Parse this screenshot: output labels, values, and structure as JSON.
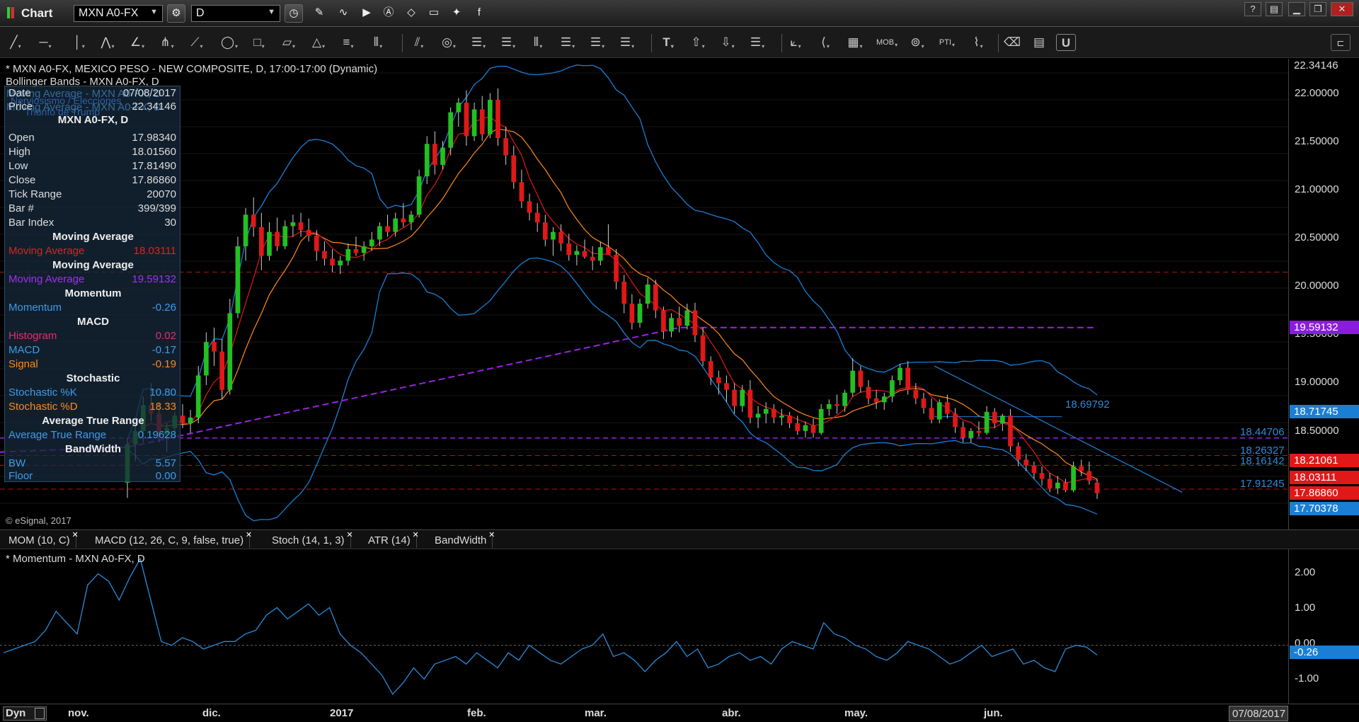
{
  "app": {
    "title": "Chart"
  },
  "toolbar": {
    "symbol": "MXN A0-FX",
    "interval": "D"
  },
  "pane": {
    "title": "* MXN A0-FX, MEXICO PESO - NEW COMPOSITE, D, 17:00-17:00 (Dynamic)",
    "study": "Bollinger Bands - MXN A0-FX, D",
    "copyright": "© eSignal, 2017"
  },
  "ghost_text": {
    "line1": "Moving Average - MXN A0-FX, D",
    "line2": "Moving Average - MXN A0-FX, D",
    "line3": "Nerviosismo / Elecciones",
    "line4": "Triunfo de Trump"
  },
  "data_window": {
    "date": {
      "label": "Date",
      "value": "07/08/2017"
    },
    "price": {
      "label": "Price",
      "value": "22.34146"
    },
    "symbol_header": "MXN A0-FX, D",
    "rows": [
      {
        "label": "Open",
        "value": "17.98340"
      },
      {
        "label": "High",
        "value": "18.01560"
      },
      {
        "label": "Low",
        "value": "17.81490"
      },
      {
        "label": "Close",
        "value": "17.86860"
      },
      {
        "label": "Tick Range",
        "value": "20070"
      },
      {
        "label": "Bar #",
        "value": "399/399"
      },
      {
        "label": "Bar Index",
        "value": "30"
      }
    ],
    "ma1_header": "Moving Average",
    "ma1": {
      "label": "Moving Average",
      "value": "18.03111"
    },
    "ma2_header": "Moving Average",
    "ma2": {
      "label": "Moving Average",
      "value": "19.59132"
    },
    "mom_header": "Momentum",
    "mom": {
      "label": "Momentum",
      "value": "-0.26"
    },
    "macd_header": "MACD",
    "macd_rows": [
      {
        "label": "Histogram",
        "value": "0.02"
      },
      {
        "label": "MACD",
        "value": "-0.17"
      },
      {
        "label": "Signal",
        "value": "-0.19"
      }
    ],
    "stoch_header": "Stochastic",
    "stoch_rows": [
      {
        "label": "Stochastic %K",
        "value": "10.80"
      },
      {
        "label": "Stochastic %D",
        "value": "18.33"
      }
    ],
    "atr_header": "Average True Range",
    "atr": {
      "label": "Average True Range",
      "value": "0.19628"
    },
    "bw_header": "BandWidth",
    "bw_rows": [
      {
        "label": "BW",
        "value": "5.57"
      },
      {
        "label": "Floor",
        "value": "0.00"
      }
    ]
  },
  "price_axis": {
    "ticks": [
      "22.00000",
      "21.50000",
      "21.00000",
      "20.50000",
      "20.00000",
      "19.50000",
      "19.00000",
      "18.50000"
    ],
    "top_value": "22.34146",
    "tags": [
      {
        "text": "19.59132",
        "color": "#8a1ce0"
      },
      {
        "text": "18.71745",
        "color": "#1a7fd4"
      },
      {
        "text": "18.21061",
        "color": "#e01818"
      },
      {
        "text": "18.03111",
        "color": "#e01818"
      },
      {
        "text": "17.86860",
        "color": "#e01818"
      },
      {
        "text": "17.70378",
        "color": "#1a7fd4"
      }
    ]
  },
  "level_labels": [
    "18.69792",
    "18.44706",
    "18.26327",
    "18.16142",
    "17.91245"
  ],
  "indicator_tabs": [
    "MOM (10, C)",
    "MACD (12, 26, C, 9, false, true)",
    "Stoch (14, 1, 3)",
    "ATR (14)",
    "BandWidth"
  ],
  "momentum_pane": {
    "title": "* Momentum - MXN A0-FX, D",
    "ticks": [
      "2.00",
      "1.00",
      "0.00",
      "-1.00"
    ],
    "tag": "-0.26"
  },
  "time_axis": {
    "mode": "Dyn",
    "labels": [
      "nov.",
      "dic.",
      "2017",
      "feb.",
      "mar.",
      "abr.",
      "may.",
      "jun."
    ],
    "cursor_date": "07/08/2017"
  },
  "colors": {
    "up_candle": "#22c022",
    "down_candle": "#e01818",
    "bollinger": "#1a7fd4",
    "ma_fast": "#e01818",
    "ma_slow": "#ff8a1a",
    "ma_200": "#9b22e6"
  },
  "chart_data": {
    "type": "candlestick",
    "symbol": "MXN A0-FX",
    "ylim": [
      17.55,
      22.35
    ],
    "candles": [
      [
        17.98,
        18.45,
        17.82,
        18.38
      ],
      [
        18.38,
        18.6,
        18.2,
        18.52
      ],
      [
        18.52,
        18.88,
        18.4,
        18.79
      ],
      [
        18.79,
        19.02,
        18.62,
        18.7
      ],
      [
        18.7,
        18.82,
        18.4,
        18.48
      ],
      [
        18.48,
        18.6,
        18.3,
        18.55
      ],
      [
        18.55,
        18.72,
        18.44,
        18.68
      ],
      [
        18.68,
        18.8,
        18.55,
        18.6
      ],
      [
        18.6,
        18.74,
        18.5,
        18.66
      ],
      [
        18.66,
        19.2,
        18.6,
        19.1
      ],
      [
        19.1,
        19.55,
        19.0,
        19.45
      ],
      [
        19.45,
        19.6,
        19.2,
        19.35
      ],
      [
        19.35,
        19.48,
        18.85,
        18.95
      ],
      [
        18.95,
        19.9,
        18.9,
        19.75
      ],
      [
        19.75,
        20.55,
        19.7,
        20.45
      ],
      [
        20.45,
        20.85,
        20.3,
        20.78
      ],
      [
        20.78,
        20.96,
        20.55,
        20.65
      ],
      [
        20.65,
        20.8,
        20.2,
        20.35
      ],
      [
        20.35,
        20.7,
        20.3,
        20.6
      ],
      [
        20.6,
        20.75,
        20.4,
        20.45
      ],
      [
        20.45,
        20.72,
        20.42,
        20.66
      ],
      [
        20.66,
        20.78,
        20.55,
        20.7
      ],
      [
        20.7,
        20.8,
        20.55,
        20.62
      ],
      [
        20.62,
        20.74,
        20.5,
        20.56
      ],
      [
        20.56,
        20.62,
        20.3,
        20.4
      ],
      [
        20.4,
        20.5,
        20.25,
        20.32
      ],
      [
        20.32,
        20.42,
        20.18,
        20.25
      ],
      [
        20.25,
        20.35,
        20.16,
        20.3
      ],
      [
        20.3,
        20.48,
        20.25,
        20.42
      ],
      [
        20.42,
        20.55,
        20.35,
        20.38
      ],
      [
        20.38,
        20.5,
        20.3,
        20.45
      ],
      [
        20.45,
        20.6,
        20.4,
        20.52
      ],
      [
        20.52,
        20.7,
        20.45,
        20.66
      ],
      [
        20.66,
        20.78,
        20.55,
        20.6
      ],
      [
        20.6,
        20.8,
        20.55,
        20.74
      ],
      [
        20.74,
        20.9,
        20.65,
        20.7
      ],
      [
        20.7,
        20.82,
        20.62,
        20.78
      ],
      [
        20.78,
        21.25,
        20.75,
        21.18
      ],
      [
        21.18,
        21.6,
        21.1,
        21.52
      ],
      [
        21.52,
        21.65,
        21.2,
        21.3
      ],
      [
        21.3,
        21.55,
        21.25,
        21.48
      ],
      [
        21.48,
        21.9,
        21.4,
        21.85
      ],
      [
        21.85,
        22.0,
        21.7,
        21.95
      ],
      [
        21.95,
        22.08,
        21.5,
        21.6
      ],
      [
        21.6,
        21.95,
        21.55,
        21.88
      ],
      [
        21.88,
        22.02,
        21.55,
        21.62
      ],
      [
        21.62,
        22.05,
        21.58,
        21.98
      ],
      [
        21.98,
        22.1,
        21.5,
        21.58
      ],
      [
        21.58,
        21.7,
        21.3,
        21.4
      ],
      [
        21.4,
        21.5,
        21.05,
        21.12
      ],
      [
        21.12,
        21.25,
        20.85,
        20.92
      ],
      [
        20.92,
        21.0,
        20.72,
        20.8
      ],
      [
        20.8,
        20.9,
        20.6,
        20.7
      ],
      [
        20.7,
        20.78,
        20.45,
        20.52
      ],
      [
        20.52,
        20.65,
        20.35,
        20.6
      ],
      [
        20.6,
        20.68,
        20.4,
        20.48
      ],
      [
        20.48,
        20.58,
        20.3,
        20.36
      ],
      [
        20.36,
        20.46,
        20.25,
        20.4
      ],
      [
        20.4,
        20.52,
        20.32,
        20.34
      ],
      [
        20.34,
        20.45,
        20.2,
        20.3
      ],
      [
        20.3,
        20.5,
        20.25,
        20.44
      ],
      [
        20.44,
        20.68,
        20.4,
        20.36
      ],
      [
        20.36,
        20.42,
        20.0,
        20.08
      ],
      [
        20.08,
        20.15,
        19.75,
        19.85
      ],
      [
        19.85,
        19.95,
        19.58,
        19.65
      ],
      [
        19.65,
        19.9,
        19.6,
        19.85
      ],
      [
        19.85,
        20.12,
        19.8,
        20.05
      ],
      [
        20.05,
        20.1,
        19.7,
        19.78
      ],
      [
        19.78,
        19.82,
        19.48,
        19.56
      ],
      [
        19.56,
        19.75,
        19.5,
        19.7
      ],
      [
        19.7,
        19.82,
        19.55,
        19.62
      ],
      [
        19.62,
        19.85,
        19.58,
        19.78
      ],
      [
        19.78,
        19.86,
        19.45,
        19.52
      ],
      [
        19.52,
        19.6,
        19.2,
        19.25
      ],
      [
        19.25,
        19.3,
        19.0,
        19.08
      ],
      [
        19.08,
        19.15,
        18.9,
        19.02
      ],
      [
        19.02,
        19.1,
        18.82,
        18.95
      ],
      [
        18.95,
        19.02,
        18.7,
        18.78
      ],
      [
        18.78,
        19.0,
        18.72,
        18.95
      ],
      [
        18.95,
        19.05,
        18.6,
        18.66
      ],
      [
        18.66,
        18.78,
        18.55,
        18.7
      ],
      [
        18.7,
        18.82,
        18.6,
        18.75
      ],
      [
        18.75,
        18.8,
        18.6,
        18.66
      ],
      [
        18.66,
        18.75,
        18.58,
        18.68
      ],
      [
        18.68,
        18.72,
        18.55,
        18.6
      ],
      [
        18.6,
        18.68,
        18.48,
        18.52
      ],
      [
        18.52,
        18.62,
        18.45,
        18.58
      ],
      [
        18.58,
        18.65,
        18.45,
        18.5
      ],
      [
        18.5,
        18.8,
        18.48,
        18.75
      ],
      [
        18.75,
        18.85,
        18.68,
        18.8
      ],
      [
        18.8,
        18.9,
        18.7,
        18.78
      ],
      [
        18.78,
        18.95,
        18.72,
        18.92
      ],
      [
        18.92,
        19.28,
        18.88,
        19.15
      ],
      [
        19.15,
        19.2,
        18.92,
        18.98
      ],
      [
        18.98,
        19.05,
        18.8,
        18.86
      ],
      [
        18.86,
        18.95,
        18.75,
        18.82
      ],
      [
        18.82,
        18.92,
        18.74,
        18.88
      ],
      [
        18.88,
        19.1,
        18.82,
        19.05
      ],
      [
        19.05,
        19.22,
        19.0,
        19.18
      ],
      [
        19.18,
        19.25,
        18.9,
        18.95
      ],
      [
        18.95,
        19.02,
        18.8,
        18.86
      ],
      [
        18.86,
        18.92,
        18.7,
        18.76
      ],
      [
        18.76,
        18.86,
        18.6,
        18.64
      ],
      [
        18.64,
        18.85,
        18.6,
        18.82
      ],
      [
        18.82,
        18.9,
        18.65,
        18.7
      ],
      [
        18.7,
        18.76,
        18.5,
        18.56
      ],
      [
        18.56,
        18.62,
        18.4,
        18.45
      ],
      [
        18.45,
        18.55,
        18.4,
        18.52
      ],
      [
        18.52,
        18.62,
        18.46,
        18.5
      ],
      [
        18.5,
        18.78,
        18.48,
        18.72
      ],
      [
        18.72,
        18.76,
        18.55,
        18.6
      ],
      [
        18.6,
        18.7,
        18.52,
        18.68
      ],
      [
        18.68,
        18.75,
        18.3,
        18.36
      ],
      [
        18.36,
        18.4,
        18.15,
        18.22
      ],
      [
        18.22,
        18.28,
        18.1,
        18.16
      ],
      [
        18.16,
        18.2,
        18.02,
        18.08
      ],
      [
        18.08,
        18.15,
        17.95,
        18.02
      ],
      [
        18.02,
        18.08,
        17.88,
        17.92
      ],
      [
        17.92,
        18.05,
        17.86,
        17.98
      ],
      [
        17.98,
        18.02,
        17.88,
        17.9
      ],
      [
        17.9,
        18.2,
        17.88,
        18.15
      ],
      [
        18.15,
        18.22,
        18.05,
        18.1
      ],
      [
        18.1,
        18.2,
        17.96,
        18.0
      ],
      [
        17.98,
        18.02,
        17.81,
        17.87
      ]
    ],
    "ma_fast_last": 18.03111,
    "ma_slow_last": 18.21061,
    "ma_200_last": 19.59132,
    "bollinger_upper_last": 18.71745,
    "bollinger_lower_last": 17.70378,
    "horizontal_levels": [
      20.18,
      18.44706,
      18.26327,
      18.16142,
      17.91245
    ],
    "trendline": [
      [
        19.2,
        18.2
      ]
    ],
    "momentum_ylim": [
      -1.4,
      2.4
    ],
    "momentum": [
      -0.2,
      -0.1,
      0.0,
      0.1,
      0.4,
      0.9,
      0.6,
      0.3,
      1.6,
      1.9,
      1.7,
      1.2,
      1.8,
      2.3,
      1.2,
      0.1,
      0.0,
      0.2,
      0.1,
      -0.1,
      0.0,
      0.1,
      0.1,
      0.3,
      0.4,
      0.8,
      1.0,
      0.7,
      0.9,
      1.1,
      0.8,
      1.0,
      0.3,
      0.0,
      -0.2,
      -0.5,
      -0.8,
      -1.3,
      -1.0,
      -0.6,
      -0.9,
      -0.5,
      -0.4,
      -0.3,
      -0.5,
      -0.2,
      -0.4,
      -0.6,
      -0.2,
      -0.4,
      0.0,
      -0.2,
      -0.4,
      -0.5,
      -0.3,
      -0.1,
      0.0,
      0.3,
      -0.3,
      -0.2,
      -0.4,
      -0.7,
      -0.4,
      -0.2,
      0.1,
      -0.3,
      -0.1,
      -0.6,
      -0.5,
      -0.3,
      -0.2,
      -0.4,
      -0.3,
      -0.5,
      -0.1,
      0.1,
      0.0,
      -0.1,
      0.6,
      0.3,
      0.2,
      0.0,
      -0.1,
      -0.3,
      -0.4,
      -0.2,
      0.1,
      0.0,
      -0.1,
      -0.3,
      -0.5,
      -0.4,
      -0.2,
      0.0,
      -0.3,
      -0.2,
      -0.1,
      -0.5,
      -0.4,
      -0.6,
      -0.7,
      -0.1,
      0.0,
      -0.05,
      -0.26
    ]
  }
}
